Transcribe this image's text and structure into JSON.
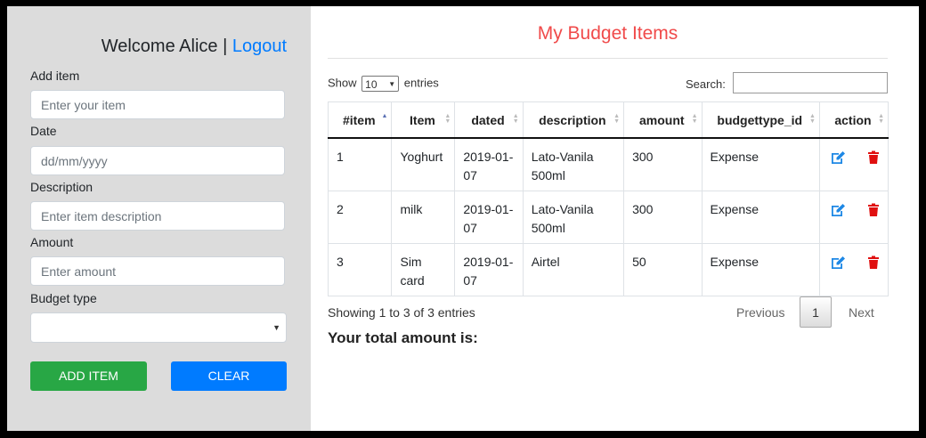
{
  "header": {
    "welcome_text": "Welcome Alice |",
    "logout_label": "Logout"
  },
  "form": {
    "item_label": "Add item",
    "item_placeholder": "Enter your item",
    "date_label": "Date",
    "date_placeholder": "dd/mm/yyyy",
    "desc_label": "Description",
    "desc_placeholder": "Enter item description",
    "amount_label": "Amount",
    "amount_placeholder": "Enter amount",
    "budget_label": "Budget type",
    "budget_value": "",
    "add_button": "ADD ITEM",
    "clear_button": "CLEAR"
  },
  "main": {
    "title": "My Budget Items",
    "show_prefix": "Show",
    "show_value": "10",
    "show_suffix": "entries",
    "search_label": "Search:",
    "columns": [
      "#item",
      "Item",
      "dated",
      "description",
      "amount",
      "budgettype_id",
      "action"
    ],
    "rows": [
      {
        "id": "1",
        "item": "Yoghurt",
        "dated": "2019-01-07",
        "description": "Lato-Vanila 500ml",
        "amount": "300",
        "type": "Expense"
      },
      {
        "id": "2",
        "item": "milk",
        "dated": "2019-01-07",
        "description": "Lato-Vanila 500ml",
        "amount": "300",
        "type": "Expense"
      },
      {
        "id": "3",
        "item": "Sim card",
        "dated": "2019-01-07",
        "description": "Airtel",
        "amount": "50",
        "type": "Expense"
      }
    ],
    "info": "Showing 1 to 3 of 3 entries",
    "pagination": {
      "previous": "Previous",
      "current": "1",
      "next": "Next"
    },
    "total_label": "Your total amount is:"
  },
  "icons": {
    "edit": "edit-icon",
    "delete": "trash-icon"
  },
  "colors": {
    "title": "#f04a4a",
    "add": "#28a745",
    "clear": "#007bff",
    "link": "#007bff",
    "delete": "#e01010"
  }
}
